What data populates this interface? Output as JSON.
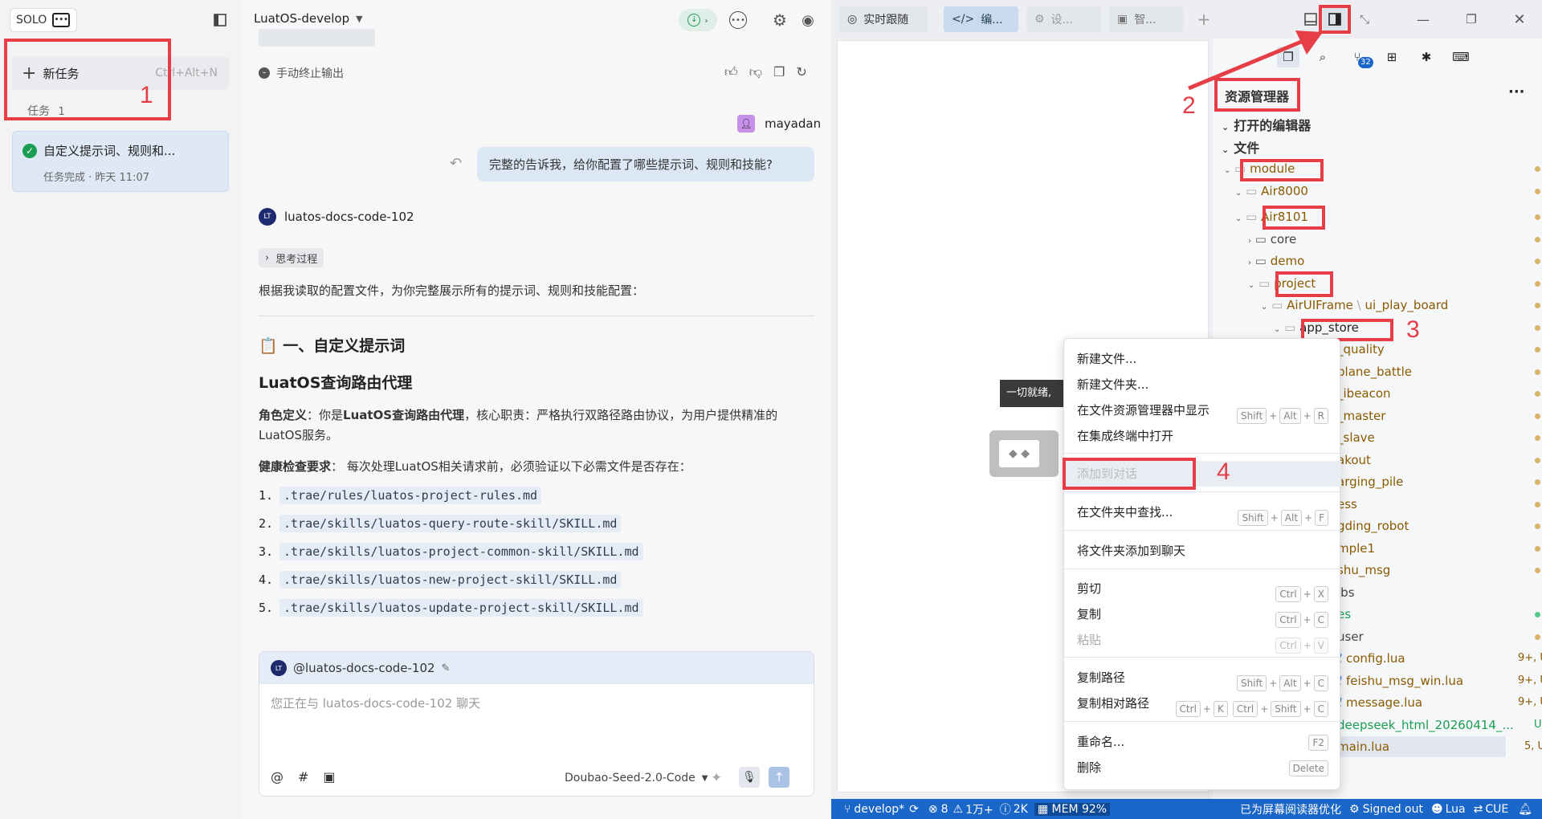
{
  "left": {
    "solo": "SOLO",
    "new_task": "新任务",
    "new_task_shortcut": "Ctrl+Alt+N",
    "tasks_label": "任务",
    "tasks_count": "1",
    "task_title": "自定义提示词、规则和...",
    "task_sub": "任务完成 · 昨天 11:07"
  },
  "mid": {
    "branch": "LuatOS-develop",
    "stop_output": "手动终止输出",
    "user_name": "mayadan",
    "user_msg": "完整的告诉我，给你配置了哪些提示词、规则和技能?",
    "agent_name": "luatos-docs-code-102",
    "thinking": "思考过程",
    "intro": "根据我读取的配置文件，为你完整展示所有的提示词、规则和技能配置：",
    "h2": "📋 一、自定义提示词",
    "h3": "LuatOS查询路由代理",
    "role_label": "角色定义",
    "role_pre": "：你是",
    "role_bold": "LuatOS查询路由代理",
    "role_rest": "，核心职责：严格执行双路径路由协议，为用户提供精准的LuatOS服务。",
    "health_label": "健康检查要求",
    "health_rest": "： 每次处理LuatOS相关请求前，必须验证以下必需文件是否存在：",
    "files": [
      ".trae/rules/luatos-project-rules.md",
      ".trae/skills/luatos-query-route-skill/SKILL.md",
      ".trae/skills/luatos-project-common-skill/SKILL.md",
      ".trae/skills/luatos-new-project-skill/SKILL.md",
      ".trae/skills/luatos-update-project-skill/SKILL.md"
    ],
    "nums": [
      "1.",
      "2.",
      "3.",
      "4.",
      "5."
    ],
    "input_agent": "@luatos-docs-code-102",
    "input_placeholder": "您正在与 luatos-docs-code-102 聊天",
    "model": "Doubao-Seed-2.0-Code"
  },
  "right": {
    "tabs": [
      "实时跟随",
      "编...",
      "设...",
      "智..."
    ],
    "explorer_title": "资源管理器",
    "open_editors": "打开的编辑器",
    "files_section": "文件",
    "tree": [
      "module",
      "Air8000",
      "Air8101",
      "core",
      "demo",
      "project",
      "AirUIFrame",
      "ui_play_board",
      "app_store",
      "_quality",
      "plane_battle",
      "_ibeacon",
      "_master",
      "_slave",
      "akout",
      "arging_pile",
      "ess",
      "gding_robot",
      "mple1",
      "shu_msg",
      "ibs",
      "es",
      "user",
      "config.lua",
      "feishu_msg_win.lua",
      "message.lua",
      "deepseek_html_20260414_...",
      "main.lua"
    ],
    "tree_status": [
      "9+, U",
      "9+, U",
      "9+, U",
      "U",
      "5, U"
    ],
    "overlay_text": "一切就绪,",
    "badge": "32"
  },
  "menu": {
    "items": [
      "新建文件...",
      "新建文件夹...",
      "在文件资源管理器中显示",
      "在集成终端中打开",
      "添加到对话",
      "在文件夹中查找...",
      "将文件夹添加到聊天",
      "剪切",
      "复制",
      "粘贴",
      "复制路径",
      "复制相对路径",
      "重命名...",
      "删除"
    ],
    "keys": {
      "shift": "Shift",
      "alt": "Alt",
      "ctrl": "Ctrl",
      "r": "R",
      "f": "F",
      "x": "X",
      "c": "C",
      "v": "V",
      "k": "K",
      "f2": "F2",
      "del": "Delete"
    }
  },
  "status": {
    "branch": "develop*",
    "errors": "8",
    "warnings": "1万+",
    "info": "2K",
    "mem": "MEM 92%",
    "reader": "已为屏幕阅读器优化",
    "signed": "Signed out",
    "lang": "Lua",
    "cue": "CUE"
  },
  "annotations": [
    "1",
    "2",
    "3",
    "4"
  ]
}
